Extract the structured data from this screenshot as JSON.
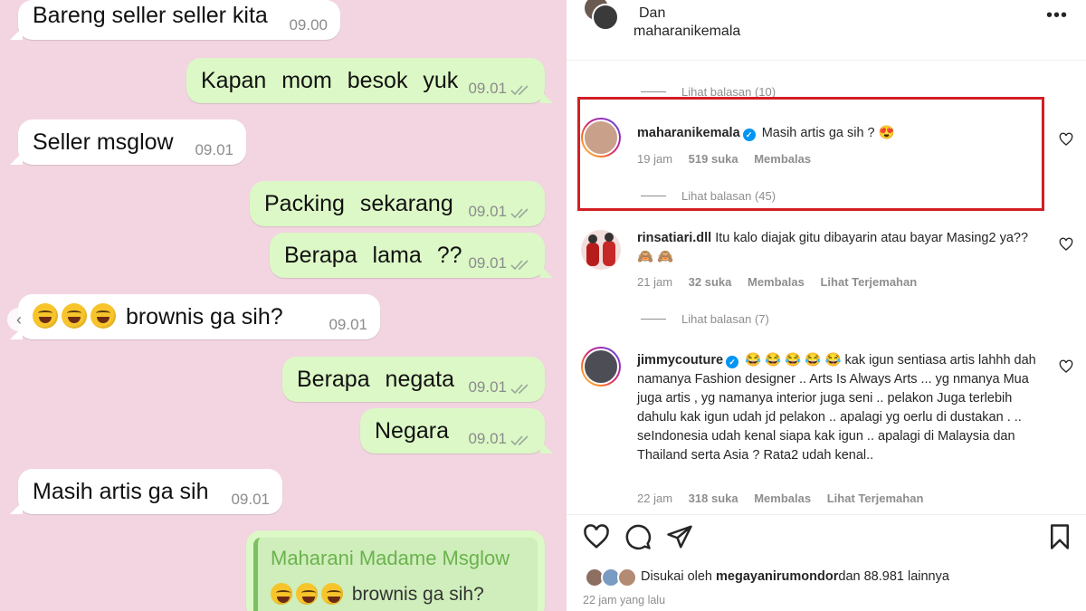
{
  "chat": {
    "messages": [
      {
        "text": "Bareng seller seller kita",
        "time": "09.00",
        "dir": "in"
      },
      {
        "text": "Kapan mom besok yuk",
        "time": "09.01",
        "dir": "out"
      },
      {
        "text": "Seller msglow",
        "time": "09.01",
        "dir": "in"
      },
      {
        "text": "Packing sekarang",
        "time": "09.01",
        "dir": "out"
      },
      {
        "text": "Berapa lama ??",
        "time": "09.01",
        "dir": "out"
      },
      {
        "text": "brownis ga sih?",
        "time": "09.01",
        "dir": "in",
        "emoji_count": 3
      },
      {
        "text": "Berapa negata",
        "time": "09.01",
        "dir": "out"
      },
      {
        "text": "Negara",
        "time": "09.01",
        "dir": "out"
      },
      {
        "text": "Masih artis ga sih",
        "time": "09.01",
        "dir": "in"
      }
    ],
    "quoted": {
      "name": "Maharani Madame Msglow",
      "text": "brownis ga sih?",
      "emoji_count": 3
    },
    "scroll_arrow_icon": "chevron-left-icon"
  },
  "instagram": {
    "header": {
      "dan": "Dan",
      "username": "maharanikemala",
      "more_icon": "more-dots-icon"
    },
    "top_replies": "Lihat balasan (10)",
    "comments": [
      {
        "user": "maharanikemala",
        "verified": true,
        "text": "Masih artis ga sih ? 😍",
        "age": "19 jam",
        "likes": "519 suka",
        "reply": "Membalas",
        "translate": "",
        "replies": "Lihat balasan (45)",
        "highlighted": true
      },
      {
        "user": "rinsatiari.dll",
        "verified": false,
        "text": "Itu kalo diajak gitu dibayarin atau bayar Masing2 ya?? 🙈 🙈",
        "age": "21 jam",
        "likes": "32 suka",
        "reply": "Membalas",
        "translate": "Lihat Terjemahan",
        "replies": "Lihat balasan (7)"
      },
      {
        "user": "jimmycouture",
        "verified": true,
        "text": "😂 😂 😂 😂 😂 kak igun sentiasa artis lahhh dah namanya Fashion designer .. Arts Is Always Arts ... yg nmanya Mua juga artis , yg namanya interior juga seni .. pelakon Juga terlebih dahulu kak igun udah jd pelakon .. apalagi yg oerlu di dustakan . .. seIndonesia udah kenal siapa kak igun .. apalagi di Malaysia dan Thailand serta Asia ? Rata2 udah kenal..",
        "age": "22 jam",
        "likes": "318 suka",
        "reply": "Membalas",
        "translate": "Lihat Terjemahan",
        "replies": ""
      }
    ],
    "actions": {
      "like_icon": "heart-icon",
      "comment_icon": "comment-icon",
      "share_icon": "share-icon",
      "save_icon": "bookmark-icon"
    },
    "liked_by": {
      "prefix": "Disukai oleh ",
      "user": "megayanirumondor",
      "suffix": "dan 88.981 lainnya"
    },
    "time_ago": "22 jam yang lalu"
  },
  "colors": {
    "chat_bg": "#f2d5e1",
    "bubble_out": "#dcf8c6",
    "bubble_in": "#ffffff",
    "highlight": "#d21f26",
    "verified": "#0095f6"
  }
}
